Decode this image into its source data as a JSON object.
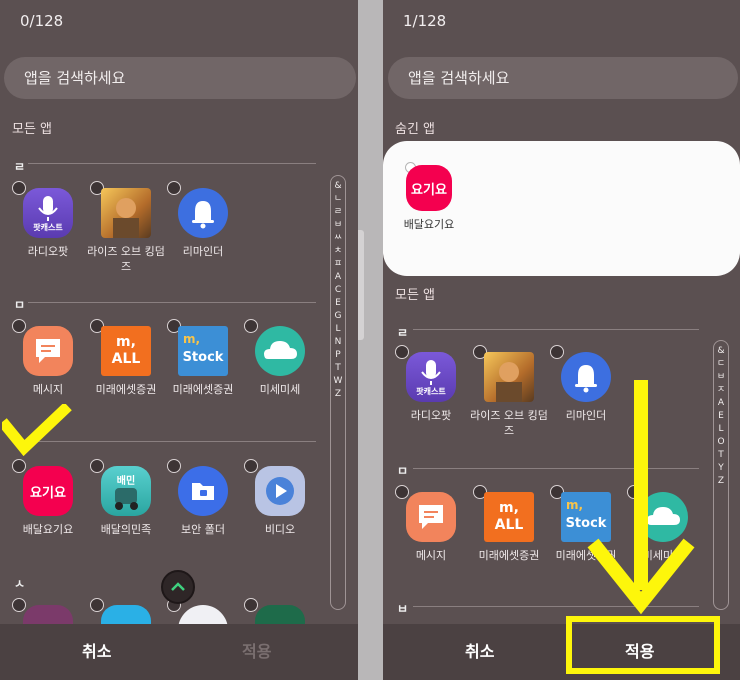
{
  "left": {
    "counter": "0/128",
    "search_placeholder": "앱을 검색하세요",
    "section_all": "모든 앱",
    "groups": [
      "ㄹ",
      "ㅁ",
      "ㅂ",
      "ㅅ"
    ],
    "apps": {
      "radio": "라디오팟",
      "rise": "라이즈 오브 킹덤즈",
      "reminder": "리마인더",
      "message": "메시지",
      "mirae1": "미래에셋증권",
      "mirae2": "미래에셋증권",
      "dust": "미세미세",
      "yogiyo": "배달요기요",
      "baemin": "배달의민족",
      "folder": "보안 폴더",
      "video": "비디오"
    },
    "alpha": [
      "&",
      "ㄴ",
      "ㄹ",
      "ㅂ",
      "ㅆ",
      "ㅊ",
      "ㅍ",
      "A",
      "C",
      "E",
      "G",
      "L",
      "N",
      "P",
      "T",
      "W",
      "Z"
    ],
    "cancel": "취소",
    "apply": "적용"
  },
  "right": {
    "counter": "1/128",
    "search_placeholder": "앱을 검색하세요",
    "section_hidden": "숨긴 앱",
    "section_all": "모든 앱",
    "groups": [
      "ㄹ",
      "ㅁ",
      "ㅂ"
    ],
    "hidden_apps": {
      "yogiyo": "배달요기요"
    },
    "apps": {
      "radio": "라디오팟",
      "rise": "라이즈 오브 킹덤즈",
      "reminder": "리마인더",
      "message": "메시지",
      "mirae1": "미래에셋증권",
      "mirae2": "미래에셋증권",
      "dust": "미세미세"
    },
    "alpha": [
      "&",
      "ㄷ",
      "ㅂ",
      "ㅈ",
      "A",
      "E",
      "L",
      "O",
      "T",
      "Y",
      "Z"
    ],
    "cancel": "취소",
    "apply": "적용"
  },
  "icon_text": {
    "radio": "팟캐스트",
    "yogiyo": "요기요",
    "mirae_m": "m,",
    "mirae_all": "ALL",
    "stock_m": "m,",
    "stock": "Stock",
    "baemin": "배민"
  },
  "annotation_color": "#fdf60b"
}
